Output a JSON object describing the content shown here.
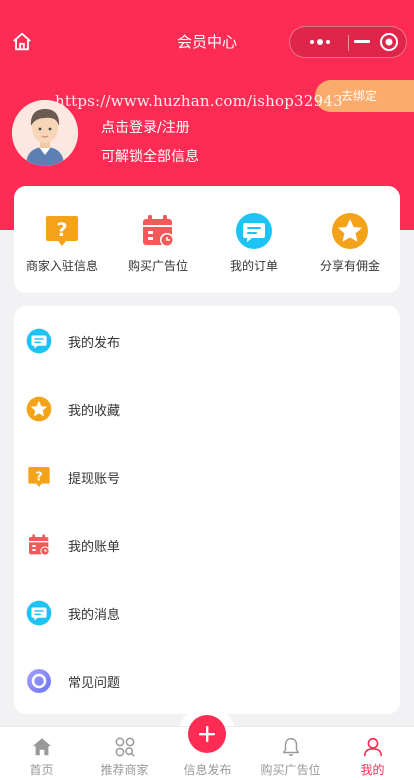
{
  "header": {
    "title": "会员中心"
  },
  "bind_badge": "去绑定",
  "watermark": "https://www.huzhan.com/ishop32943",
  "user": {
    "login_text": "点击登录/注册",
    "unlock_text": "可解锁全部信息"
  },
  "quick_actions": [
    {
      "label": "商家入驻信息",
      "icon": "question-bubble-icon"
    },
    {
      "label": "购买广告位",
      "icon": "calendar-icon"
    },
    {
      "label": "我的订单",
      "icon": "message-icon"
    },
    {
      "label": "分享有佣金",
      "icon": "star-icon"
    }
  ],
  "menu": [
    {
      "label": "我的发布",
      "icon": "message-icon"
    },
    {
      "label": "我的收藏",
      "icon": "star-icon"
    },
    {
      "label": "提现账号",
      "icon": "question-bubble-icon"
    },
    {
      "label": "我的账单",
      "icon": "calendar-icon"
    },
    {
      "label": "我的消息",
      "icon": "message-icon"
    },
    {
      "label": "常见问题",
      "icon": "ring-icon"
    }
  ],
  "tabbar": [
    {
      "label": "首页",
      "icon": "home-icon"
    },
    {
      "label": "推荐商家",
      "icon": "grid-search-icon"
    },
    {
      "label": "信息发布",
      "icon": "plus-icon"
    },
    {
      "label": "购买广告位",
      "icon": "bell-icon"
    },
    {
      "label": "我的",
      "icon": "user-icon",
      "active": true
    }
  ],
  "colors": {
    "brand": "#fe2c55",
    "badge": "#fbab6c",
    "orange": "#f5a21b",
    "cyan": "#1ec3f5",
    "calendar_red": "#f25a5a"
  }
}
